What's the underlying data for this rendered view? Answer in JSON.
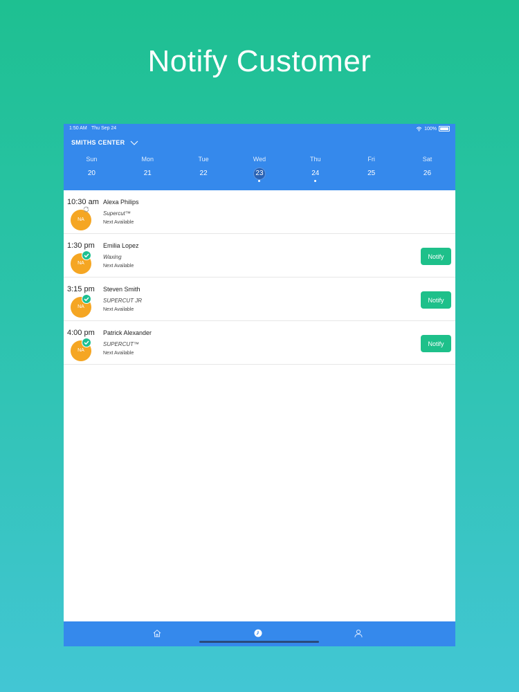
{
  "headline": "Notify Customer",
  "status_bar": {
    "time": "1:50 AM",
    "date": "Thu Sep 24",
    "battery": "100%"
  },
  "location": {
    "name": "SMITHS CENTER"
  },
  "calendar": {
    "days": [
      {
        "name": "Sun",
        "num": "20",
        "selected": false,
        "dot": false
      },
      {
        "name": "Mon",
        "num": "21",
        "selected": false,
        "dot": false
      },
      {
        "name": "Tue",
        "num": "22",
        "selected": false,
        "dot": false
      },
      {
        "name": "Wed",
        "num": "23",
        "selected": true,
        "dot": true
      },
      {
        "name": "Thu",
        "num": "24",
        "selected": false,
        "dot": true
      },
      {
        "name": "Fri",
        "num": "25",
        "selected": false,
        "dot": false
      },
      {
        "name": "Sat",
        "num": "26",
        "selected": false,
        "dot": false
      }
    ]
  },
  "appointments": [
    {
      "time": "10:30 am",
      "name": "Alexa Philips",
      "service": "Supercut™",
      "availability": "Next Available",
      "initials": "NA",
      "status": "pending"
    },
    {
      "time": "1:30 pm",
      "name": "Emilia Lopez",
      "service": "Waxing",
      "availability": "Next Available",
      "initials": "NA",
      "status": "checked",
      "notify_label": "Notify"
    },
    {
      "time": "3:15 pm",
      "name": "Steven Smith",
      "service": "SUPERCUT JR",
      "availability": "Next Available",
      "initials": "NA",
      "status": "checked",
      "notify_label": "Notify"
    },
    {
      "time": "4:00 pm",
      "name": "Patrick Alexander",
      "service": "SUPERCUT™",
      "availability": "Next Available",
      "initials": "NA",
      "status": "checked",
      "notify_label": "Notify"
    }
  ],
  "colors": {
    "primary": "#3589ec",
    "accent": "#1ec08a",
    "avatar": "#f5a623"
  },
  "tabbar": {
    "icons": [
      "home-icon",
      "clock-icon",
      "user-icon"
    ],
    "active": "clock-icon"
  }
}
